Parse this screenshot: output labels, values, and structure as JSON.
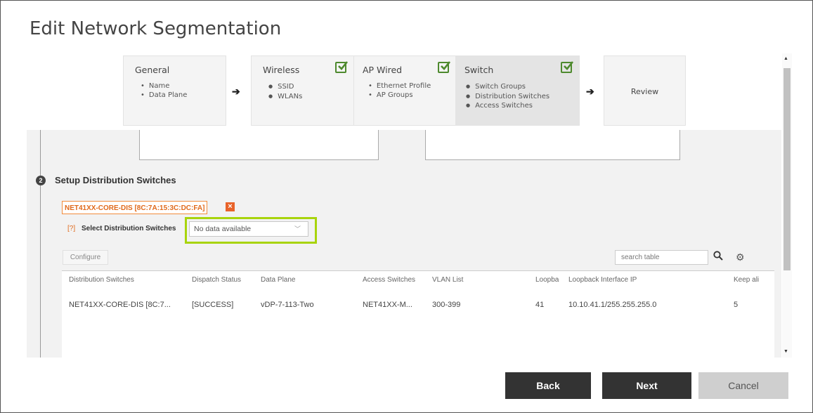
{
  "page": {
    "title": "Edit Network Segmentation"
  },
  "steps": [
    {
      "title": "General",
      "items": [
        "Name",
        "Data Plane"
      ],
      "checked": false
    },
    {
      "title": "Wireless",
      "items": [
        "SSID",
        "WLANs"
      ],
      "checked": true
    },
    {
      "title": "AP Wired",
      "items": [
        "Ethernet Profile",
        "AP Groups"
      ],
      "checked": true
    },
    {
      "title": "Switch",
      "items": [
        "Switch Groups",
        "Distribution Switches",
        "Access Switches"
      ],
      "checked": true,
      "active": true
    },
    {
      "title": "Review"
    }
  ],
  "arrow": "➔",
  "section": {
    "number": "2",
    "title": "Setup Distribution Switches",
    "tag": "NET41XX-CORE-DIS [8C:7A:15:3C:DC:FA]",
    "tag_close": "×",
    "help": "[?]",
    "select_label": "Select Distribution Switches",
    "select_value": "No data available",
    "select_chevron": "﹀"
  },
  "toolbar": {
    "configure_label": "Configure",
    "search_placeholder": "search table",
    "gear": "⚙"
  },
  "table": {
    "columns": [
      "Distribution Switches",
      "Dispatch Status",
      "Data Plane",
      "Access Switches",
      "VLAN List",
      "Loopbac",
      "Loopback Interface IP",
      "Keep ali"
    ],
    "rows": [
      [
        "NET41XX-CORE-DIS [8C:7...",
        "[SUCCESS]",
        "vDP-7-113-Two",
        "NET41XX-M...",
        "300-399",
        "41",
        "10.10.41.1/255.255.255.0",
        "5"
      ]
    ]
  },
  "scroll": {
    "up": "▲",
    "down": "▼"
  },
  "footer": {
    "back": "Back",
    "next": "Next",
    "cancel": "Cancel"
  },
  "colors": {
    "accent_orange": "#e06a1c",
    "highlight_green": "#a8d40c",
    "check_green": "#4e8a2e",
    "button_dark": "#333333"
  }
}
